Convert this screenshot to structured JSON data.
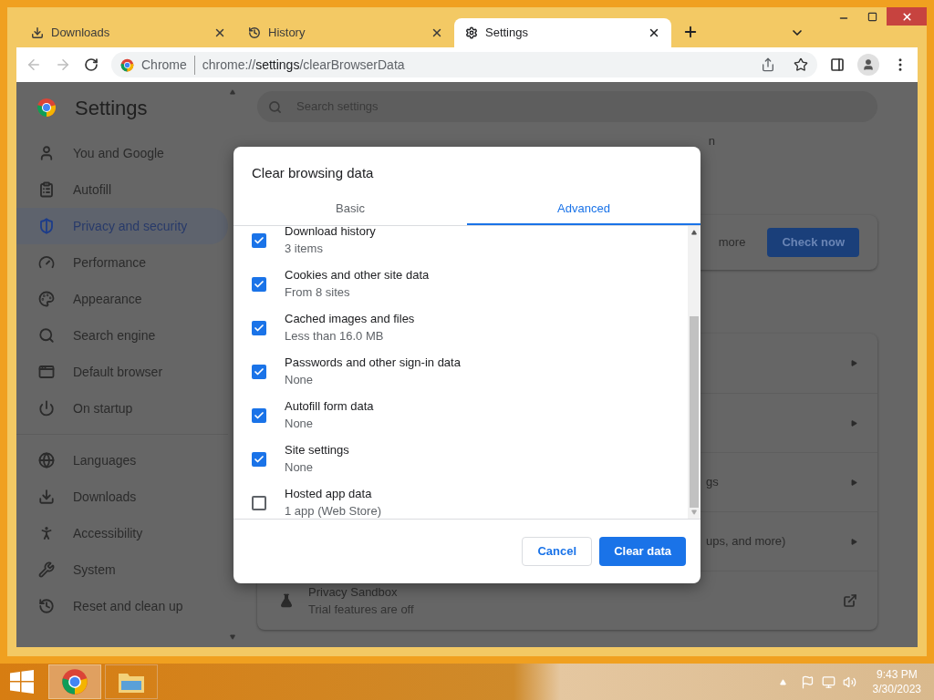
{
  "browser": {
    "tabs": [
      {
        "label": "Downloads",
        "selected": false
      },
      {
        "label": "History",
        "selected": false
      },
      {
        "label": "Settings",
        "selected": true
      }
    ],
    "address": {
      "site_label": "Chrome",
      "url_scheme": "chrome://",
      "url_host": "settings",
      "url_path": "/clearBrowserData"
    }
  },
  "settings": {
    "title": "Settings",
    "search_placeholder": "Search settings",
    "sidebar": [
      [
        {
          "label": "You and Google",
          "selected": false
        },
        {
          "label": "Autofill",
          "selected": false
        },
        {
          "label": "Privacy and security",
          "selected": true
        },
        {
          "label": "Performance",
          "selected": false
        },
        {
          "label": "Appearance",
          "selected": false
        },
        {
          "label": "Search engine",
          "selected": false
        },
        {
          "label": "Default browser",
          "selected": false
        },
        {
          "label": "On startup",
          "selected": false
        }
      ],
      [
        {
          "label": "Languages",
          "selected": false
        },
        {
          "label": "Downloads",
          "selected": false
        },
        {
          "label": "Accessibility",
          "selected": false
        },
        {
          "label": "System",
          "selected": false
        },
        {
          "label": "Reset and clean up",
          "selected": false
        }
      ]
    ],
    "fragment": "n",
    "safety_card": {
      "text": "more",
      "button": "Check now"
    },
    "rows": [
      {
        "kind": "arrow"
      },
      {
        "kind": "arrow"
      },
      {
        "kind": "arrow",
        "text": "gs"
      },
      {
        "kind": "arrow",
        "text": "ups, and more)"
      },
      {
        "kind": "external",
        "title": "Privacy Sandbox",
        "subtitle": "Trial features are off"
      }
    ]
  },
  "dialog": {
    "title": "Clear browsing data",
    "tabs": [
      {
        "label": "Basic",
        "selected": false
      },
      {
        "label": "Advanced",
        "selected": true
      }
    ],
    "items": [
      {
        "label": "Download history",
        "detail": "3 items",
        "checked": true
      },
      {
        "label": "Cookies and other site data",
        "detail": "From 8 sites",
        "checked": true
      },
      {
        "label": "Cached images and files",
        "detail": "Less than 16.0 MB",
        "checked": true
      },
      {
        "label": "Passwords and other sign-in data",
        "detail": "None",
        "checked": true
      },
      {
        "label": "Autofill form data",
        "detail": "None",
        "checked": true
      },
      {
        "label": "Site settings",
        "detail": "None",
        "checked": true
      },
      {
        "label": "Hosted app data",
        "detail": "1 app (Web Store)",
        "checked": false
      }
    ],
    "buttons": {
      "cancel": "Cancel",
      "confirm": "Clear data"
    }
  },
  "taskbar": {
    "time": "9:43 PM",
    "date": "3/30/2023"
  }
}
